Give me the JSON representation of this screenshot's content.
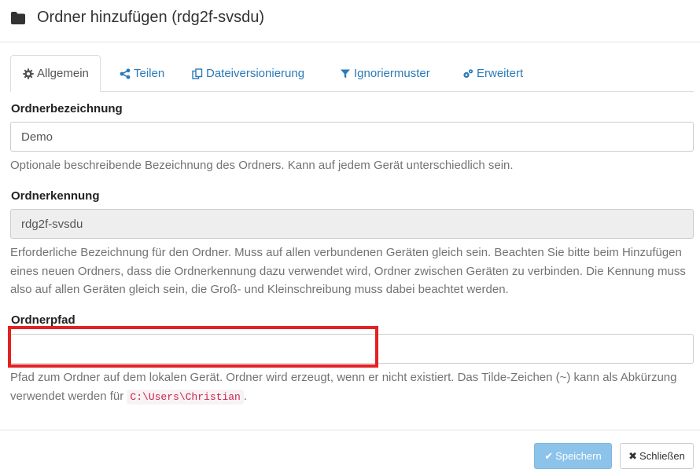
{
  "modal": {
    "title": "Ordner hinzufügen (rdg2f-svsdu)",
    "title_icon": "folder-icon"
  },
  "tabs": [
    {
      "label": "Allgemein",
      "icon": "gear-icon",
      "active": true
    },
    {
      "label": "Teilen",
      "icon": "share-icon",
      "active": false
    },
    {
      "label": "Dateiversionierung",
      "icon": "files-icon",
      "active": false
    },
    {
      "label": "Ignoriermuster",
      "icon": "filter-icon",
      "active": false
    },
    {
      "label": "Erweitert",
      "icon": "gears-icon",
      "active": false
    }
  ],
  "fields": {
    "label": {
      "label": "Ordnerbezeichnung",
      "value": "Demo",
      "help": "Optionale beschreibende Bezeichnung des Ordners. Kann auf jedem Gerät unterschiedlich sein."
    },
    "id": {
      "label": "Ordnerkennung",
      "value": "rdg2f-svsdu",
      "help": "Erforderliche Bezeichnung für den Ordner. Muss auf allen verbundenen Geräten gleich sein. Beachten Sie bitte beim Hinzufügen eines neuen Ordners, dass die Ordnerkennung dazu verwendet wird, Ordner zwischen Geräten zu verbinden. Die Kennung muss also auf allen Geräten gleich sein, die Groß- und Kleinschreibung muss dabei beachtet werden."
    },
    "path": {
      "label": "Ordnerpfad",
      "value": "",
      "help_before": "Pfad zum Ordner auf dem lokalen Gerät. Ordner wird erzeugt, wenn er nicht existiert. Das Tilde-Zeichen (~) kann als Abkürzung verwendet werden für",
      "help_code": "C:\\Users\\Christian",
      "help_after": "."
    }
  },
  "footer": {
    "save_label": "Speichern",
    "close_label": "Schließen"
  },
  "colors": {
    "link": "#2a7ab8",
    "save_button": "#8cc3ea",
    "highlight_box": "#e32124",
    "code_text": "#c7254e"
  }
}
